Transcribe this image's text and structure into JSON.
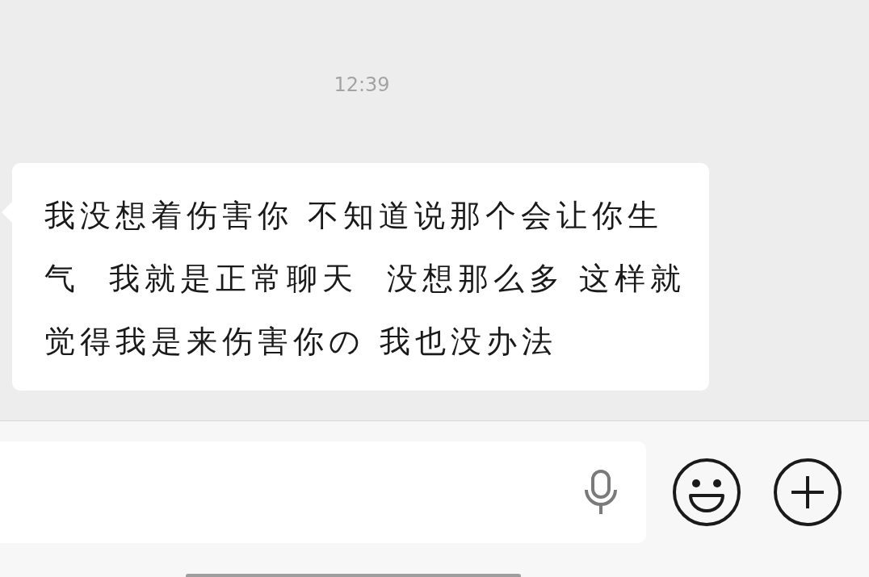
{
  "timestamp": "12:39",
  "messages": [
    {
      "kind": "received",
      "text": "我没想着伤害你 不知道说那个会让你生气  我就是正常聊天  没想那么多 这样就觉得我是来伤害你の 我也没办法"
    }
  ]
}
